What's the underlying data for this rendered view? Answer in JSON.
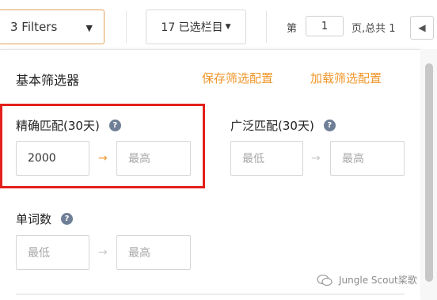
{
  "toolbar": {
    "filter_select": "3 Filters",
    "columns_button": "17 已选栏目",
    "page_prefix": "第",
    "page_value": "1",
    "page_suffix": "页,总共 1"
  },
  "panel": {
    "title": "基本筛选器",
    "save_link": "保存筛选配置",
    "load_link": "加载筛选配置"
  },
  "filters": {
    "exact_match": {
      "label": "精确匹配(30天)",
      "min_value": "2000",
      "max_placeholder": "最高"
    },
    "broad_match": {
      "label": "广泛匹配(30天)",
      "min_placeholder": "最低",
      "max_placeholder": "最高"
    },
    "word_count": {
      "label": "单词数",
      "min_placeholder": "最低",
      "max_placeholder": "最高"
    }
  },
  "help_glyph": "?",
  "watermark": "Jungle Scout桨歌",
  "colors": {
    "accent": "#f0962a",
    "highlight": "#e3201b",
    "help_icon": "#6f7f96"
  }
}
